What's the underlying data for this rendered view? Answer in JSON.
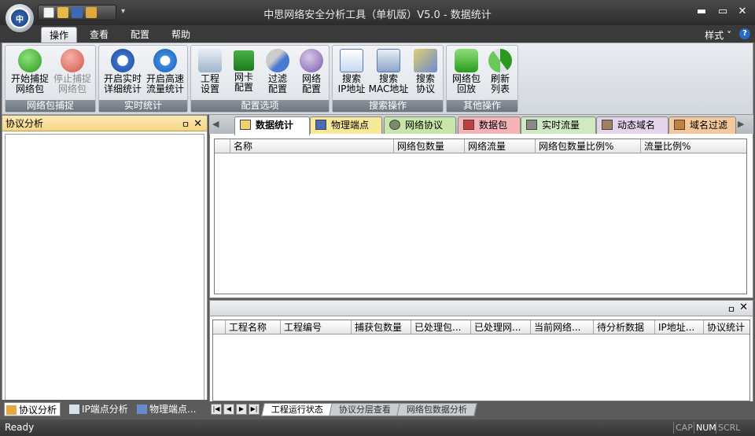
{
  "window": {
    "title": "中思网络安全分析工具（单机版）V5.0 - 数据统计",
    "controls": {
      "minimize": "▬",
      "maximize": "▭",
      "close": "✕"
    }
  },
  "quick_access": {
    "icons": [
      "new-file-icon",
      "open-folder-icon",
      "save-icon",
      "folder-icon"
    ],
    "more": "▾"
  },
  "menu_tabs": [
    "操作",
    "查看",
    "配置",
    "帮助"
  ],
  "style_label": "样式",
  "help_icon": "?",
  "ribbon": {
    "groups": [
      {
        "title": "网络包捕捉",
        "buttons": [
          {
            "l1": "开始捕捉",
            "l2": "网络包",
            "icon": "play-icon",
            "disabled": false
          },
          {
            "l1": "停止捕捉",
            "l2": "网络包",
            "icon": "stop-icon",
            "disabled": true
          }
        ]
      },
      {
        "title": "实时统计",
        "buttons": [
          {
            "l1": "开启实时",
            "l2": "详细统计",
            "icon": "realtime-icon",
            "disabled": false
          },
          {
            "l1": "开启高速",
            "l2": "流量统计",
            "icon": "speed-search-icon",
            "disabled": false
          }
        ]
      },
      {
        "title": "配置选项",
        "buttons": [
          {
            "l1": "工程",
            "l2": "设置",
            "icon": "project-settings-icon",
            "disabled": false
          },
          {
            "l1": "网卡",
            "l2": "配置",
            "icon": "network-card-icon",
            "disabled": false
          },
          {
            "l1": "过滤",
            "l2": "配置",
            "icon": "filter-scissors-icon",
            "disabled": false
          },
          {
            "l1": "网络",
            "l2": "配置",
            "icon": "network-globe-icon",
            "disabled": false
          }
        ]
      },
      {
        "title": "搜索操作",
        "buttons": [
          {
            "l1": "搜索",
            "l2": "IP地址",
            "icon": "search-ip-icon",
            "disabled": false
          },
          {
            "l1": "搜索",
            "l2": "MAC地址",
            "icon": "search-mac-icon",
            "disabled": false
          },
          {
            "l1": "搜索",
            "l2": "协议",
            "icon": "search-protocol-icon",
            "disabled": false
          }
        ]
      },
      {
        "title": "其他操作",
        "buttons": [
          {
            "l1": "网络包",
            "l2": "回放",
            "icon": "replay-camera-icon",
            "disabled": false
          },
          {
            "l1": "刷新",
            "l2": "列表",
            "icon": "refresh-icon",
            "disabled": false
          }
        ]
      }
    ]
  },
  "left_panel": {
    "title": "协议分析",
    "pin": "ㅁ",
    "close": "✕",
    "tabs": [
      "协议分析",
      "IP端点分析",
      "物理端点..."
    ]
  },
  "doc_tabs": [
    "数据统计",
    "物理端点",
    "网络协议",
    "数据包",
    "实时流量",
    "动态域名",
    "域名过滤"
  ],
  "colors": {
    "tab_yellow": "#f7e89a",
    "tab_green": "#c8e6a8",
    "tab_pink": "#f4b4b8",
    "tab_lightgreen": "#cfe9c0",
    "tab_lavender": "#e4d4ec",
    "tab_orange": "#f5c89c",
    "accent_blue": "#2a68c8"
  },
  "stats_table": {
    "headers": [
      "名称",
      "网络包数量",
      "网络流量",
      "网络包数量比例%",
      "流量比例%"
    ]
  },
  "project_panel": {
    "pin": "ㅁ",
    "close": "✕",
    "headers": [
      "工程名称",
      "工程编号",
      "捕获包数量",
      "已处理包...",
      "已处理网...",
      "当前网络...",
      "待分析数据",
      "IP地址...",
      "协议统计"
    ],
    "tabs": [
      "工程运行状态",
      "协议分层查看",
      "网络包数据分析"
    ],
    "nav": [
      "|◀",
      "◀",
      "▶",
      "▶|"
    ]
  },
  "status": {
    "text": "Ready",
    "indicators": [
      "CAP",
      "NUM",
      "SCRL"
    ]
  }
}
